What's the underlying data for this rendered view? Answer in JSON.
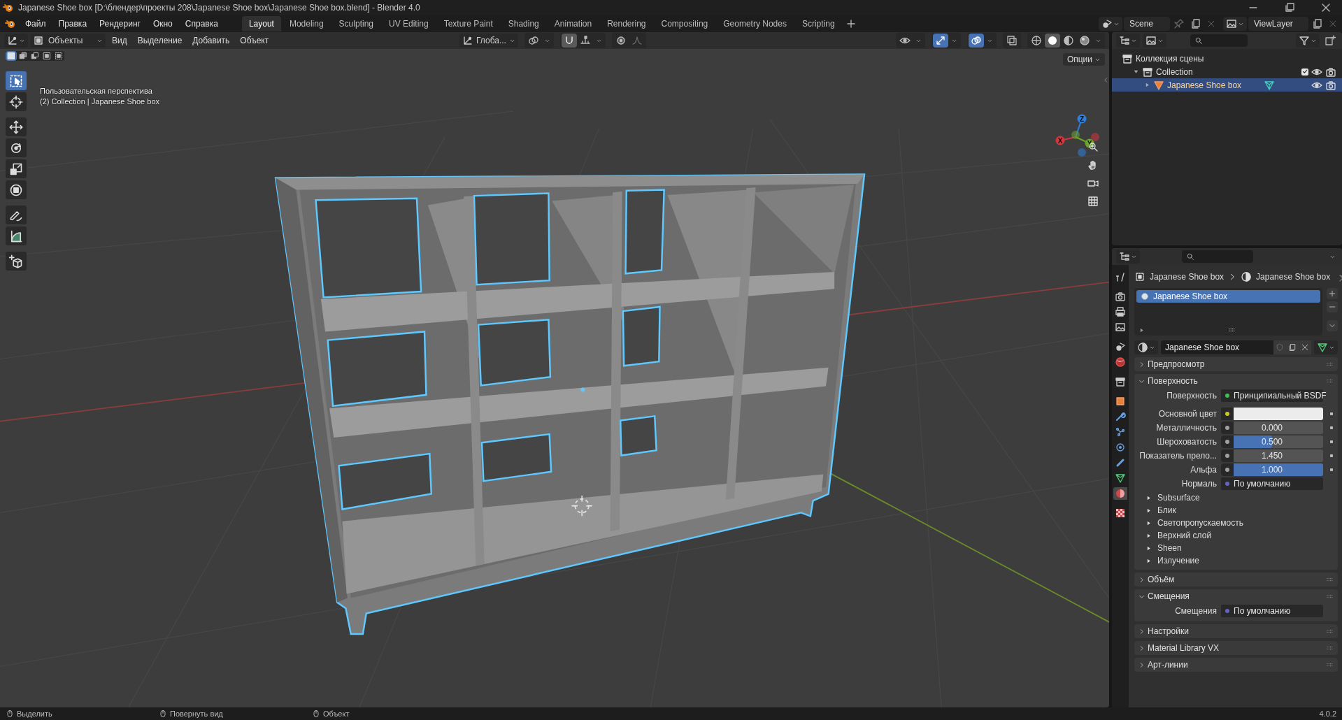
{
  "window": {
    "title": "Japanese Shoe box [D:\\блендер\\проекты 208\\Japanese Shoe box\\Japanese Shoe box.blend] - Blender 4.0"
  },
  "menu": [
    "Файл",
    "Правка",
    "Рендеринг",
    "Окно",
    "Справка"
  ],
  "workspaces": [
    {
      "label": "Layout",
      "selected": true
    },
    {
      "label": "Modeling",
      "selected": false
    },
    {
      "label": "Sculpting",
      "selected": false
    },
    {
      "label": "UV Editing",
      "selected": false
    },
    {
      "label": "Texture Paint",
      "selected": false
    },
    {
      "label": "Shading",
      "selected": false
    },
    {
      "label": "Animation",
      "selected": false
    },
    {
      "label": "Rendering",
      "selected": false
    },
    {
      "label": "Compositing",
      "selected": false
    },
    {
      "label": "Geometry Nodes",
      "selected": false
    },
    {
      "label": "Scripting",
      "selected": false
    }
  ],
  "scene": "Scene",
  "view_layer": "ViewLayer",
  "viewport_header": {
    "mode": "Объекты",
    "menus": [
      "Вид",
      "Выделение",
      "Добавить",
      "Объект"
    ],
    "orientation": "Глоба...",
    "toggles": [
      {
        "kind": "visibility",
        "on": false
      },
      {
        "kind": "gizmos",
        "on": true
      },
      {
        "kind": "overlays",
        "on": true
      },
      {
        "kind": "xray",
        "on": false
      }
    ],
    "shading": [
      {
        "kind": "wireframe",
        "selected": false
      },
      {
        "kind": "solid",
        "selected": true
      },
      {
        "kind": "material",
        "selected": false
      },
      {
        "kind": "rendered",
        "selected": false
      }
    ],
    "options": "Опции"
  },
  "select_modes": [
    {
      "kind": "set",
      "selected": true
    },
    {
      "kind": "extend",
      "selected": false
    },
    {
      "kind": "subtract",
      "selected": false
    },
    {
      "kind": "invert",
      "selected": false
    },
    {
      "kind": "intersect",
      "selected": false
    }
  ],
  "tools": [
    {
      "kind": "select",
      "selected": true
    },
    {
      "kind": "cursor",
      "selected": false
    },
    {
      "kind": "move",
      "selected": false
    },
    {
      "kind": "rotate",
      "selected": false
    },
    {
      "kind": "scale",
      "selected": false
    },
    {
      "kind": "transform",
      "selected": false
    },
    {
      "kind": "annotate",
      "selected": false
    },
    {
      "kind": "measure",
      "selected": false
    },
    {
      "kind": "add_cube",
      "selected": false
    }
  ],
  "viewport": {
    "overlay_lines": [
      "Пользовательская перспектива",
      "(2) Collection | Japanese Shoe box"
    ],
    "gizmo": [
      {
        "label": "Z",
        "kind": "z"
      },
      {
        "label": "Y",
        "kind": "y"
      },
      {
        "label": "X",
        "kind": "x"
      }
    ]
  },
  "outliner": {
    "items": [
      {
        "label": "Коллекция сцены",
        "kind": "scene_collection",
        "children": [
          {
            "label": "Collection",
            "kind": "collection",
            "expanded": true,
            "checked": true,
            "selected": false,
            "children": [
              {
                "label": "Japanese Shoe box",
                "kind": "mesh_object",
                "expanded": false,
                "selected": true
              }
            ]
          }
        ]
      }
    ]
  },
  "property_tabs": [
    {
      "kind": "tool",
      "selected": false
    },
    {
      "kind": "render",
      "selected": false
    },
    {
      "kind": "output",
      "selected": false
    },
    {
      "kind": "view_layer",
      "selected": false
    },
    {
      "kind": "scene",
      "selected": false
    },
    {
      "kind": "world",
      "selected": false
    },
    {
      "kind": "collection",
      "selected": false
    },
    {
      "kind": "object",
      "selected": false
    },
    {
      "kind": "modifiers",
      "selected": false
    },
    {
      "kind": "particles",
      "selected": false
    },
    {
      "kind": "physics",
      "selected": false
    },
    {
      "kind": "constraints",
      "selected": false
    },
    {
      "kind": "data",
      "selected": false
    },
    {
      "kind": "material",
      "selected": true
    },
    {
      "kind": "texture",
      "selected": false
    }
  ],
  "properties": {
    "breadcrumb": [
      "Japanese Shoe box",
      "Japanese Shoe box"
    ],
    "material_slots": [
      {
        "label": "Japanese Shoe box",
        "selected": true
      }
    ],
    "material_name": "Japanese Shoe box",
    "panels": [
      {
        "title": "Предпросмотр",
        "expanded": false
      },
      {
        "title": "Поверхность",
        "expanded": true,
        "rows": [
          {
            "kind": "link",
            "label": "Поверхность",
            "value": "Принципиальный BSDF",
            "color": "#3fbf4f"
          },
          {
            "kind": "color",
            "label": "Основной цвет",
            "color": "#c7c729",
            "swatch": {
              "color": "#ececec"
            }
          },
          {
            "kind": "slider",
            "label": "Металличность",
            "value": "0.000",
            "level": 0,
            "color": "#a1a1a1"
          },
          {
            "kind": "slider",
            "label": "Шероховатость",
            "value": "0.500",
            "level": 0.5,
            "color": "#a1a1a1"
          },
          {
            "kind": "number",
            "label": "Показатель прело...",
            "value": "1.450",
            "color": "#a1a1a1"
          },
          {
            "kind": "slider",
            "label": "Альфа",
            "value": "1.000",
            "level": 1,
            "color": "#a1a1a1"
          },
          {
            "kind": "link",
            "label": "Нормаль",
            "value": "По умолчанию",
            "color": "#6363c7"
          }
        ],
        "subpanels": [
          "Subsurface",
          "Блик",
          "Светопропускаемость",
          "Верхний слой",
          "Sheen",
          "Излучение"
        ]
      },
      {
        "title": "Объём",
        "expanded": false
      },
      {
        "title": "Смещения",
        "expanded": true,
        "rows": [
          {
            "kind": "link",
            "label": "Смещения",
            "value": "По умолчанию",
            "color": "#6363c7"
          }
        ]
      },
      {
        "title": "Настройки",
        "expanded": false
      },
      {
        "title": "Material Library VX",
        "expanded": false
      },
      {
        "title": "Арт-линии",
        "expanded": false
      }
    ]
  },
  "status_bar": {
    "hints": [
      "Выделить",
      "Повернуть вид",
      "Объект"
    ],
    "version": "4.0.2"
  }
}
